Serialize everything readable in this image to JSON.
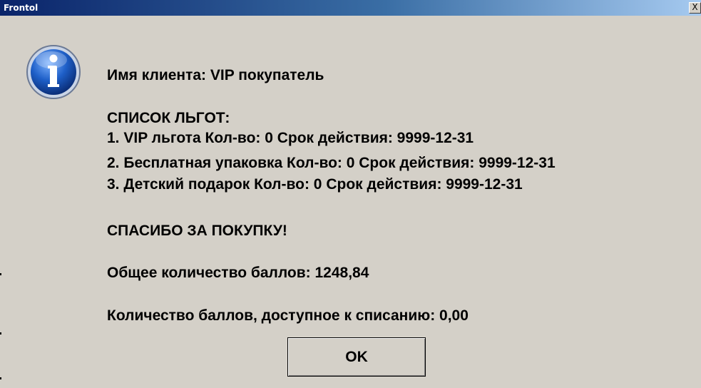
{
  "window": {
    "title": "Frontol",
    "close_label": "X"
  },
  "icon": {
    "name": "info-icon",
    "glyph": "i",
    "color": "#1e5fc8"
  },
  "message": {
    "client_line": "Имя клиента: VIP покупатель",
    "benefits_header": "СПИСОК ЛЬГОТ:",
    "benefits": [
      "1. VIP льгота Кол-во: 0 Срок действия: 9999-12-31",
      "2. Бесплатная упаковка Кол-во: 0 Срок действия: 9999-12-31",
      "3. Детский подарок Кол-во: 0 Срок действия: 9999-12-31"
    ],
    "thanks": "СПАСИБО ЗА ПОКУПКУ!",
    "total_points": "Общее количество баллов: 1248,84",
    "available_points": "Количество баллов, доступное к списанию: 0,00"
  },
  "buttons": {
    "ok_label": "OK"
  }
}
